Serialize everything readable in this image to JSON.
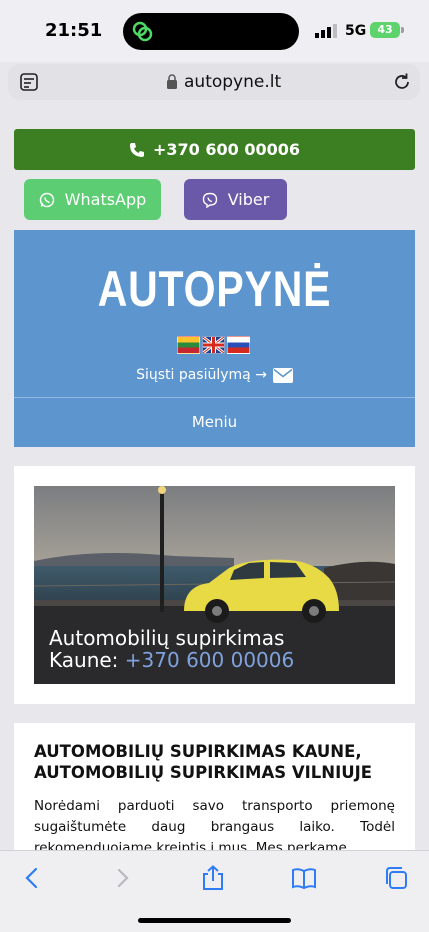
{
  "status_bar": {
    "time": "21:51",
    "network": "5G",
    "battery": "43"
  },
  "browser": {
    "url": "autopyne.lt"
  },
  "contact": {
    "phone_label": "+370 600 00006",
    "whatsapp_label": "WhatsApp",
    "viber_label": "Viber"
  },
  "header": {
    "logo": "AUTOPYNĖ",
    "languages": [
      "Lithuanian",
      "English",
      "Russian"
    ],
    "offer_link": "Siųsti pasiūlymą →",
    "menu_label": "Meniu"
  },
  "hero": {
    "title_line1": "Automobilių supirkimas",
    "title_line2_prefix": "Kaune: ",
    "title_phone": "+370 600 00006"
  },
  "article": {
    "heading": "AUTOMOBILIŲ SUPIRKIMAS KAUNE, AUTOMOBILIŲ SUPIRKIMAS VILNIUJE",
    "paragraph": "Norėdami parduoti savo transporto priemonę sugaištumėte daug brangaus laiko. Todėl rekomenduojame kreiptis į mus. Mes perkame"
  },
  "colors": {
    "call_green": "#3c7e22",
    "whatsapp_green": "#5ccd73",
    "viber_purple": "#6a59a8",
    "header_blue": "#5d95cf",
    "link_blue": "#2f7cf6"
  },
  "icons": [
    "phone-icon",
    "whatsapp-icon",
    "viber-icon",
    "envelope-icon",
    "lock-icon",
    "reload-icon",
    "back-icon",
    "forward-icon",
    "share-icon",
    "bookmarks-icon",
    "tabs-icon"
  ]
}
